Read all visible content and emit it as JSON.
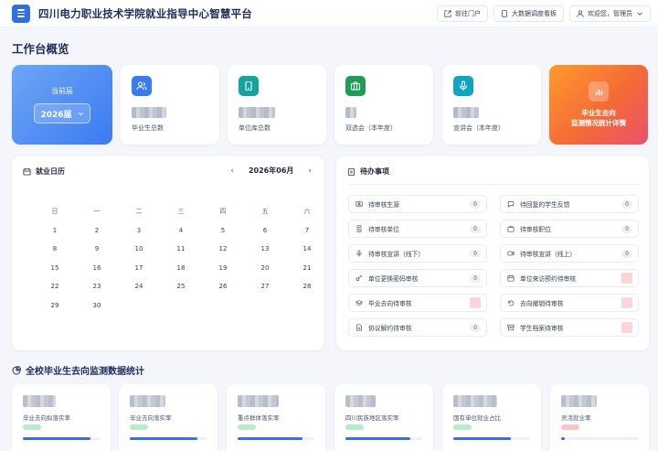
{
  "header": {
    "title": "四川电力职业技术学院就业指导中心智慧平台",
    "portal_btn": "前往门户",
    "bigdata_btn": "大数据调度看板",
    "user_btn": "欢迎您，管理员"
  },
  "overview_title": "工作台概览",
  "term": {
    "label": "当前届",
    "value": "2026届"
  },
  "stats": [
    {
      "label": "毕业生总数",
      "icon": "users-icon",
      "color": "#3b7bf0"
    },
    {
      "label": "单位库总数",
      "icon": "building-icon",
      "color": "#15a3a0"
    },
    {
      "label": "双选会（本年度）",
      "icon": "briefcase-icon",
      "color": "#1f9d55"
    },
    {
      "label": "宣讲会（本年度）",
      "icon": "microphone-icon",
      "color": "#0fa5c2"
    }
  ],
  "monitor_card": {
    "line1": "毕业生去向",
    "line2": "监测情况统计详情"
  },
  "calendar": {
    "title": "就业日历",
    "month": "2026年06月",
    "weekdays": [
      "日",
      "一",
      "二",
      "三",
      "四",
      "五",
      "六"
    ],
    "days": [
      "1",
      "2",
      "3",
      "4",
      "5",
      "6",
      "7",
      "8",
      "9",
      "10",
      "11",
      "12",
      "13",
      "14",
      "15",
      "16",
      "17",
      "18",
      "19",
      "20",
      "21",
      "22",
      "23",
      "24",
      "25",
      "26",
      "27",
      "28",
      "29",
      "30"
    ]
  },
  "todo": {
    "title": "待办事项",
    "items": [
      {
        "label": "待审核生源",
        "count": "0",
        "icon": "user-card-icon"
      },
      {
        "label": "待回复的学生反馈",
        "count": "0",
        "icon": "chat-icon"
      },
      {
        "label": "待审核单位",
        "count": "0",
        "icon": "building-icon"
      },
      {
        "label": "待审核职位",
        "count": "0",
        "icon": "briefcase-icon"
      },
      {
        "label": "待审核宣讲（线下）",
        "count": "0",
        "icon": "microphone-icon"
      },
      {
        "label": "待审核宣讲（线上）",
        "count": "0",
        "icon": "video-icon"
      },
      {
        "label": "单位更换密码审核",
        "count": "0",
        "icon": "key-icon"
      },
      {
        "label": "单位来访预约待审核",
        "count": "",
        "icon": "calendar-icon"
      },
      {
        "label": "毕业去向待审核",
        "count": "",
        "icon": "graduation-cap-icon"
      },
      {
        "label": "去向撤销待审核",
        "count": "",
        "icon": "undo-icon"
      },
      {
        "label": "协议解约待审核",
        "count": "0",
        "icon": "document-icon"
      },
      {
        "label": "学生档案待审核",
        "count": "",
        "icon": "archive-icon"
      }
    ]
  },
  "monitor_title": "全校毕业生去向监测数据统计",
  "monitor_stats": [
    {
      "label": "毕业去向拟落实率",
      "badge": "#b6ecc9",
      "progress": 0.88
    },
    {
      "label": "毕业去向落实率",
      "badge": "#b6ecc9",
      "progress": 0.88
    },
    {
      "label": "重点群体落实率",
      "badge": "#b6ecc9",
      "progress": 0.85
    },
    {
      "label": "四川民族地区落实率",
      "badge": "#b6ecc9",
      "progress": 0.85
    },
    {
      "label": "国有单位就业占比",
      "badge": "#b6ecc9",
      "progress": 0.75
    },
    {
      "label": "灵活就业率",
      "badge": "#f8c4c7",
      "progress": 0.05
    }
  ]
}
